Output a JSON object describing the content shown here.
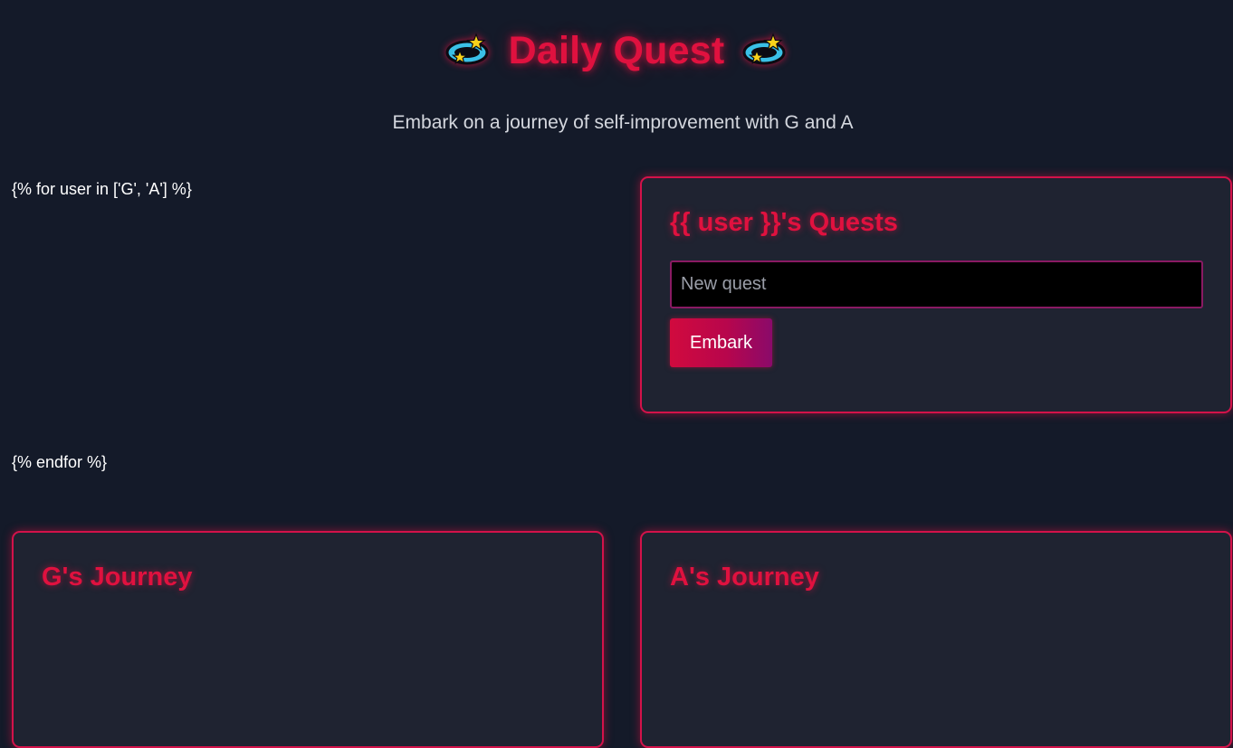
{
  "header": {
    "title": "Daily Quest",
    "subtitle": "Embark on a journey of self-improvement with G and A",
    "icons": [
      "ringed-planet-icon",
      "ringed-planet-icon"
    ]
  },
  "template": {
    "loop_start": "{% for user in ['G', 'A'] %}",
    "loop_end": "{% endfor %}"
  },
  "quest_card": {
    "title": "{{ user }}'s Quests",
    "input_placeholder": "New quest",
    "input_value": "",
    "button_label": "Embark"
  },
  "journeys": [
    {
      "title": "G's Journey"
    },
    {
      "title": "A's Journey"
    }
  ],
  "colors": {
    "background": "#141a29",
    "card_background": "#1f2331",
    "accent": "#e0113f",
    "button_gradient_end": "#8a0a6a"
  }
}
